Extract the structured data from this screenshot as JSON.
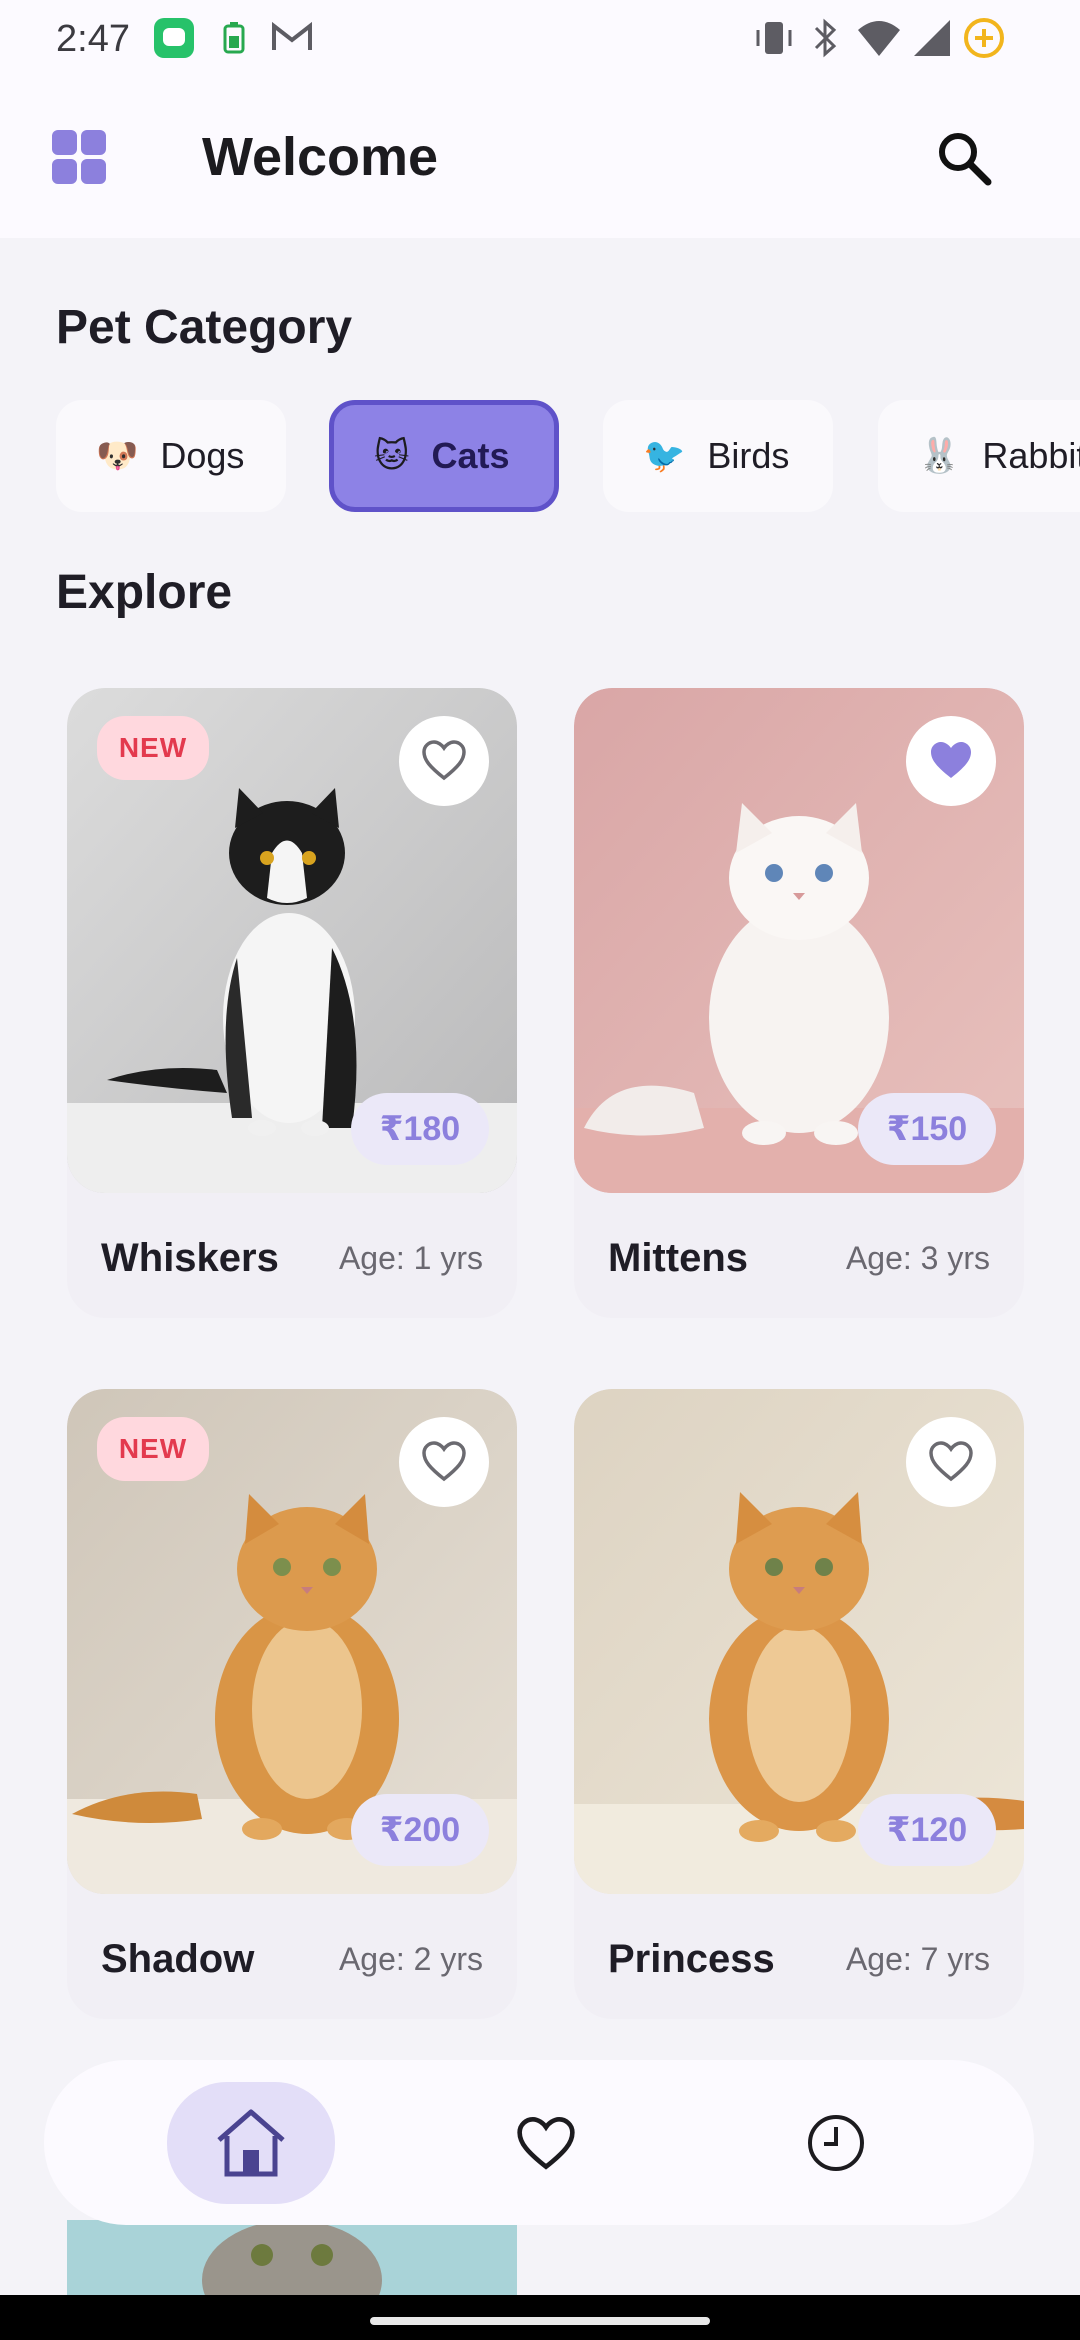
{
  "status_bar": {
    "time": "2:47",
    "icons": [
      "messages-app-icon",
      "battery-saver-icon",
      "gmail-icon",
      "vibrate-icon",
      "bluetooth-icon",
      "wifi-icon",
      "cell-signal-icon",
      "battery-icon"
    ]
  },
  "app_bar": {
    "title": "Welcome",
    "menu_icon": "grid-menu-icon",
    "search_icon": "search-icon"
  },
  "categories": {
    "title": "Pet Category",
    "items": [
      {
        "emoji": "🐶",
        "label": "Dogs",
        "selected": false
      },
      {
        "emoji": "🐱",
        "label": "Cats",
        "selected": true
      },
      {
        "emoji": "🐦",
        "label": "Birds",
        "selected": false
      },
      {
        "emoji": "🐰",
        "label": "Rabbits",
        "selected": false
      }
    ]
  },
  "explore": {
    "title": "Explore",
    "pets": [
      {
        "name": "Whiskers",
        "age": "Age: 1 yrs",
        "price": "₹180",
        "badge": "NEW",
        "favorite": false
      },
      {
        "name": "Mittens",
        "age": "Age: 3 yrs",
        "price": "₹150",
        "badge": "",
        "favorite": true
      },
      {
        "name": "Shadow",
        "age": "Age: 2 yrs",
        "price": "₹200",
        "badge": "NEW",
        "favorite": false
      },
      {
        "name": "Princess",
        "age": "Age: 7 yrs",
        "price": "₹120",
        "badge": "",
        "favorite": false
      }
    ]
  },
  "bottom_nav": {
    "items": [
      {
        "icon": "home-icon",
        "active": true
      },
      {
        "icon": "heart-icon",
        "active": false
      },
      {
        "icon": "history-clock-icon",
        "active": false
      }
    ]
  },
  "colors": {
    "accent": "#8c80dd",
    "accent_dark": "#5f52c9",
    "badge_new_bg": "#ffd8de",
    "badge_new_text": "#e33a4e",
    "background": "#f4f3f8"
  }
}
